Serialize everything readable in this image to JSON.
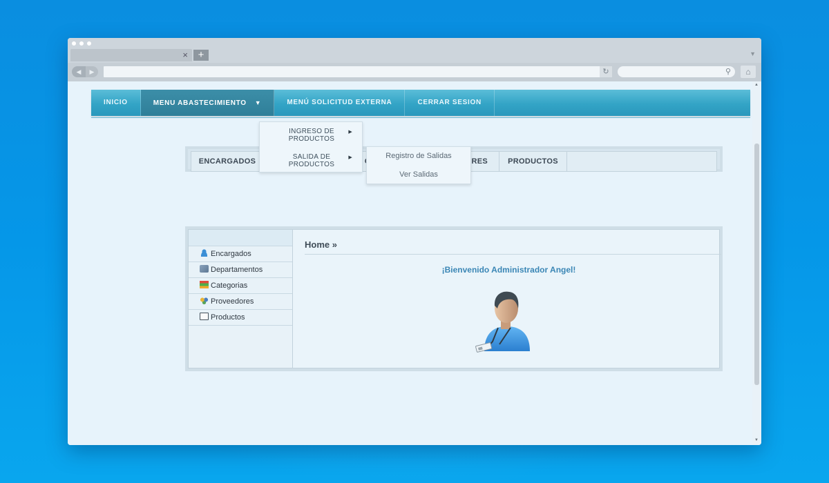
{
  "browser": {
    "tab_close": "×",
    "new_tab": "+",
    "reload_icon": "reload-icon",
    "search_icon": "search-icon",
    "home_icon": "home-icon"
  },
  "main_nav": {
    "items": [
      {
        "label": "INICIO",
        "active": false
      },
      {
        "label": "MENU ABASTECIMIENTO",
        "active": true,
        "caret": "▼"
      },
      {
        "label": "MENÚ SOLICITUD EXTERNA",
        "active": false
      },
      {
        "label": "CERRAR SESION",
        "active": false
      }
    ]
  },
  "dropdown": {
    "items": [
      {
        "line1": "INGRESO DE",
        "line2": "PRODUCTOS"
      },
      {
        "line1": "SALIDA DE",
        "line2": "PRODUCTOS"
      }
    ],
    "arrow": "▶"
  },
  "submenu": {
    "items": [
      "Registro de Salidas",
      "Ver Salidas"
    ]
  },
  "secondary_nav": {
    "items": [
      "ENCARGADOS",
      "C",
      "ORES",
      "PRODUCTOS"
    ]
  },
  "sidebar": {
    "items": [
      {
        "label": "Encargados",
        "icon": "user-icon"
      },
      {
        "label": "Departamentos",
        "icon": "department-icon"
      },
      {
        "label": "Categorias",
        "icon": "categories-icon"
      },
      {
        "label": "Proveedores",
        "icon": "providers-icon"
      },
      {
        "label": "Productos",
        "icon": "products-icon"
      }
    ]
  },
  "content": {
    "breadcrumb": "Home »",
    "welcome": "¡Bienvenido Administrador Angel!"
  },
  "colors": {
    "nav_bar": "#33a4c6",
    "nav_active": "#2f7f99",
    "welcome_text": "#3a86b5",
    "background": "#0a8ee0"
  }
}
